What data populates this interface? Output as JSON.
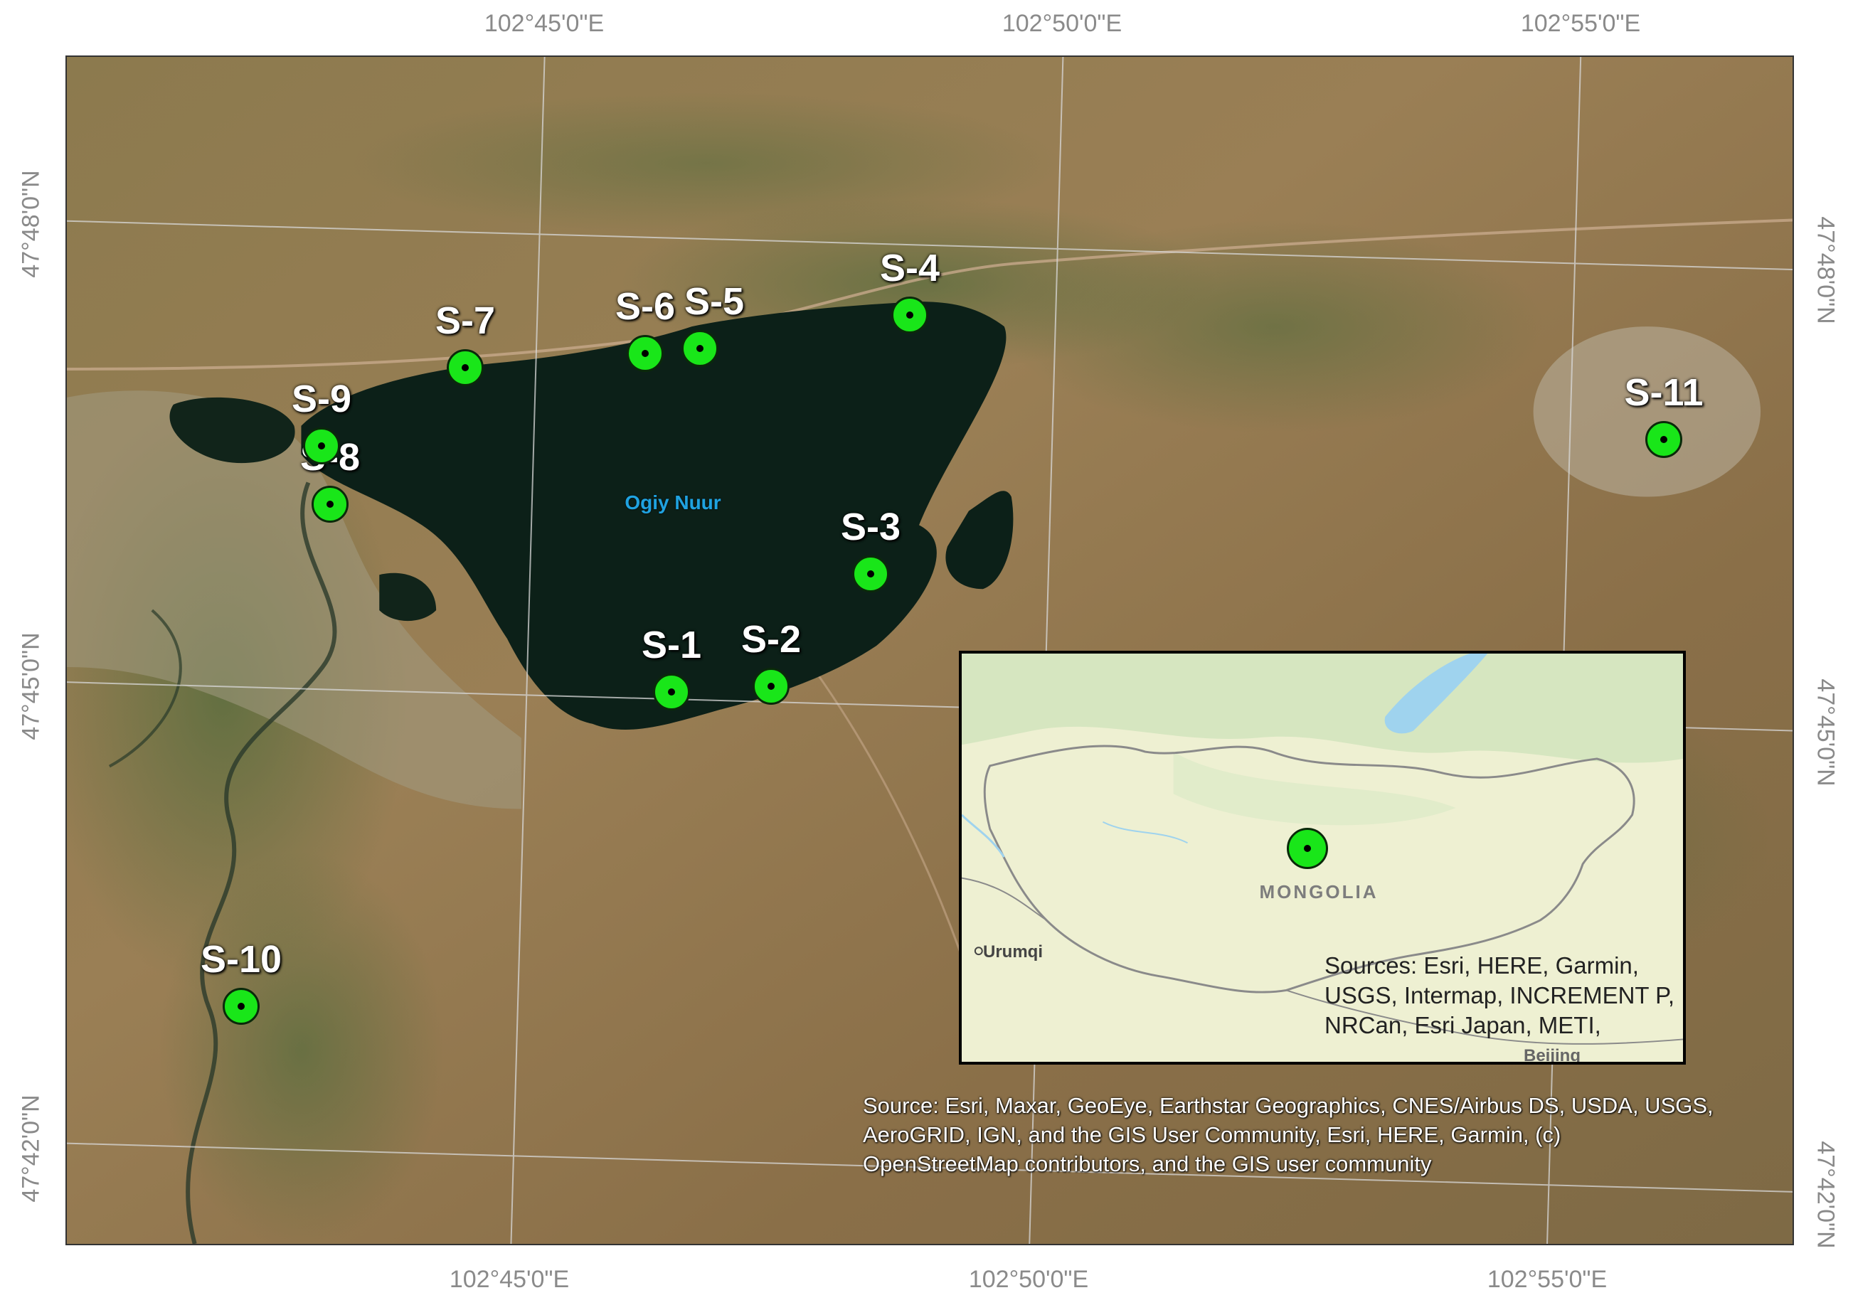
{
  "coordinates": {
    "top": [
      "102°45'0\"E",
      "102°50'0\"E",
      "102°55'0\"E"
    ],
    "bottom": [
      "102°45'0\"E",
      "102°50'0\"E",
      "102°55'0\"E"
    ],
    "left": [
      "47°48'0\"N",
      "47°45'0\"N",
      "47°42'0\"N"
    ],
    "right": [
      "47°48'0\"N",
      "47°45'0\"N",
      "47°42'0\"N"
    ]
  },
  "lake_label": "Ogiy Nuur",
  "sites": [
    "S-1",
    "S-2",
    "S-3",
    "S-4",
    "S-5",
    "S-6",
    "S-7",
    "S-8",
    "S-9",
    "S-10",
    "S-11"
  ],
  "basemap_source": "Source: Esri, Maxar, GeoEye, Earthstar Geographics, CNES/Airbus DS, USDA, USGS, AeroGRID, IGN, and the GIS User Community, Esri, HERE, Garmin, (c) OpenStreetMap contributors, and the GIS user community",
  "inset": {
    "country": "MONGOLIA",
    "city_west": "Urumqi",
    "city_south": "Beijing",
    "source": "Sources: Esri, HERE, Garmin, USGS, Intermap, INCREMENT P, NRCan, Esri Japan, METI,"
  },
  "colors": {
    "site_marker": "#19e619",
    "lake": "#0c2018",
    "lake_label": "#1fa3e0",
    "inset_land": "#eef0d2",
    "grid_lines": "#cfcfcf"
  }
}
